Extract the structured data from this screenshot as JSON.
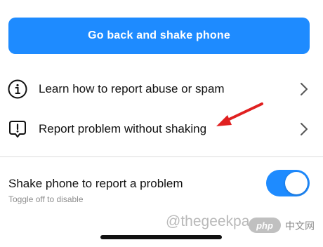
{
  "primary_action": {
    "label": "Go back and shake phone"
  },
  "menu": {
    "items": [
      {
        "label": "Learn how to report abuse or spam",
        "icon": "info-circle-icon"
      },
      {
        "label": "Report problem without shaking",
        "icon": "exclamation-bubble-icon"
      }
    ]
  },
  "shake_setting": {
    "title": "Shake phone to report a problem",
    "subtitle": "Toggle off to disable",
    "enabled": true
  },
  "watermark": {
    "site": "@thegeekpa",
    "badge": "php",
    "cn_text": "中文网"
  },
  "colors": {
    "accent": "#1e8bff",
    "annotation": "#e02020",
    "text": "#111111",
    "secondary_text": "#8e8e8e"
  }
}
